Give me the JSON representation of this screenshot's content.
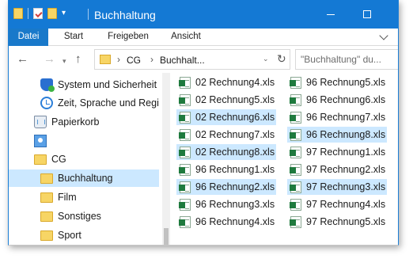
{
  "window": {
    "title": "Buchhaltung"
  },
  "titlebar": {
    "dropdown_glyph": "▾"
  },
  "ribbon": {
    "tabs": [
      "Datei",
      "Start",
      "Freigeben",
      "Ansicht"
    ]
  },
  "nav": {
    "back_glyph": "←",
    "forward_glyph": "→",
    "recent_glyph": "▾",
    "up_glyph": "↑"
  },
  "address": {
    "segments": [
      "CG",
      "Buchhalt..."
    ],
    "separator": "›",
    "dropdown_glyph": "⌄",
    "refresh_glyph": "↻"
  },
  "search": {
    "placeholder": "\"Buchhaltung\" du..."
  },
  "navpane": {
    "items": [
      {
        "label": "System und Sicherheit",
        "icon": "shield-icon"
      },
      {
        "label": "Zeit, Sprache und Regi",
        "icon": "clock-icon"
      },
      {
        "label": "Papierkorb",
        "icon": "recycle-bin-icon"
      },
      {
        "label": "",
        "icon": "user-accounts-icon"
      },
      {
        "label": "CG",
        "icon": "folder-icon"
      },
      {
        "label": "Buchhaltung",
        "icon": "folder-icon",
        "selected": true
      },
      {
        "label": "Film",
        "icon": "folder-icon"
      },
      {
        "label": "Sonstiges",
        "icon": "folder-icon"
      },
      {
        "label": "Sport",
        "icon": "folder-icon"
      }
    ]
  },
  "files": {
    "col1": [
      {
        "name": "02 Rechnung4.xls",
        "selected": false
      },
      {
        "name": "02 Rechnung5.xls",
        "selected": false
      },
      {
        "name": "02 Rechnung6.xls",
        "selected": true
      },
      {
        "name": "02 Rechnung7.xls",
        "selected": false
      },
      {
        "name": "02 Rechnung8.xls",
        "selected": true
      },
      {
        "name": "96 Rechnung1.xls",
        "selected": false
      },
      {
        "name": "96 Rechnung2.xls",
        "selected": true
      },
      {
        "name": "96 Rechnung3.xls",
        "selected": false
      },
      {
        "name": "96 Rechnung4.xls",
        "selected": false
      }
    ],
    "col2": [
      {
        "name": "96 Rechnung5.xls",
        "selected": false
      },
      {
        "name": "96 Rechnung6.xls",
        "selected": false
      },
      {
        "name": "96 Rechnung7.xls",
        "selected": false
      },
      {
        "name": "96 Rechnung8.xls",
        "selected": true
      },
      {
        "name": "97 Rechnung1.xls",
        "selected": false
      },
      {
        "name": "97 Rechnung2.xls",
        "selected": false
      },
      {
        "name": "97 Rechnung3.xls",
        "selected": true
      },
      {
        "name": "97 Rechnung4.xls",
        "selected": false
      },
      {
        "name": "97 Rechnung5.xls",
        "selected": false
      }
    ]
  },
  "colors": {
    "titlebar": "#1479d4",
    "file_tab": "#1979ca",
    "selection": "#cce8ff",
    "folder": "#f7d565",
    "excel": "#1f7a3e"
  }
}
